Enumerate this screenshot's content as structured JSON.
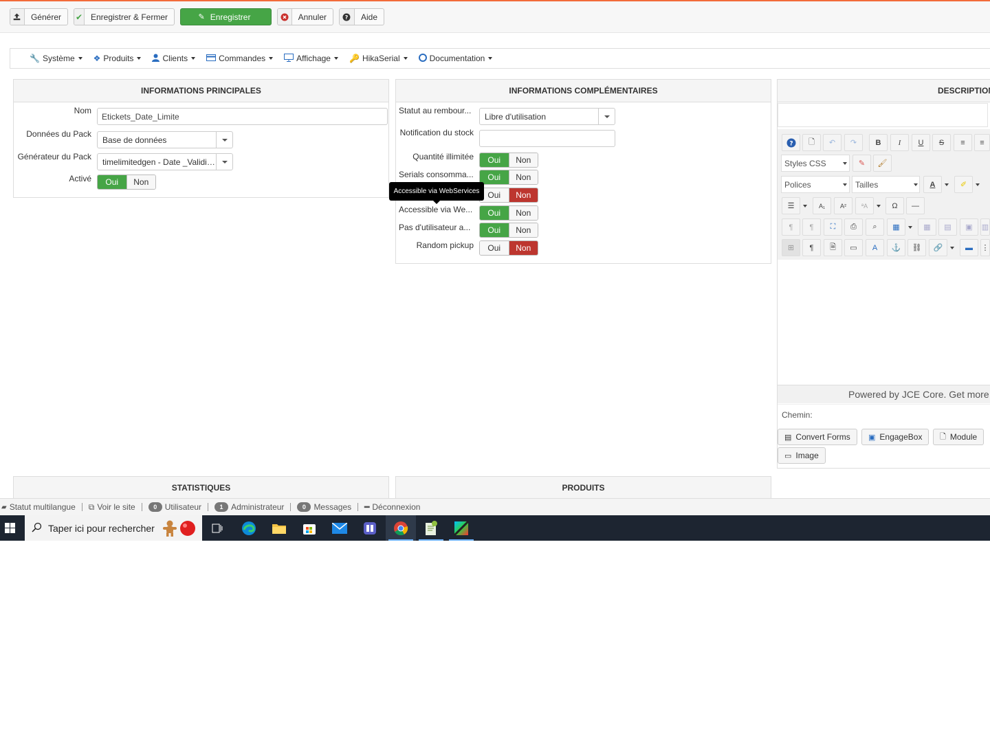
{
  "toolbar": {
    "generate": "Générer",
    "save_close": "Enregistrer & Fermer",
    "save": "Enregistrer",
    "cancel": "Annuler",
    "help": "Aide"
  },
  "menu": {
    "items": [
      "Système",
      "Produits",
      "Clients",
      "Commandes",
      "Affichage",
      "HikaSerial",
      "Documentation"
    ]
  },
  "main_info": {
    "title": "INFORMATIONS PRINCIPALES",
    "name_label": "Nom",
    "name_value": "Etickets_Date_Limite",
    "pack_data_label": "Données du Pack",
    "pack_data_value": "Base de données",
    "pack_gen_label": "Générateur du Pack",
    "pack_gen_value": "timelimitedgen - Date _Validit...",
    "active_label": "Activé",
    "active_yes": "Oui",
    "active_no": "Non"
  },
  "extra_info": {
    "title": "INFORMATIONS COMPLÉMENTAIRES",
    "refund_label": "Statut au rembour...",
    "refund_value": "Libre d'utilisation",
    "stock_label": "Notification du stock",
    "stock_value": "",
    "unlimited_label": "Quantité illimitée",
    "consumable_label": "Serials consomma...",
    "webservices_label": "Accessible via We...",
    "no_user_label": "Pas d'utilisateur a...",
    "random_label": "Random pickup",
    "yes": "Oui",
    "no": "Non",
    "tooltip": "Accessible via WebServices"
  },
  "description": {
    "title": "DESCRIPTION",
    "styles_css": "Styles CSS",
    "fonts": "Polices",
    "sizes": "Tailles",
    "powered": "Powered by JCE Core. Get more f",
    "path_label": "Chemin:",
    "btn_convert": "Convert Forms",
    "btn_engage": "EngageBox",
    "btn_module": "Module",
    "btn_image": "Image"
  },
  "bottom_panels": {
    "stats": "STATISTIQUES",
    "products": "PRODUITS"
  },
  "statusbar": {
    "multilang": "Statut multilangue",
    "view_site": "Voir le site",
    "user_count": "0",
    "user_label": "Utilisateur",
    "admin_count": "1",
    "admin_label": "Administrateur",
    "msg_count": "0",
    "msg_label": "Messages",
    "logout": "Déconnexion"
  },
  "taskbar": {
    "search_placeholder": "Taper ici pour rechercher"
  },
  "colors": {
    "accent_green": "#46a546",
    "accent_red": "#bd362f",
    "top_line": "#f26b3a"
  }
}
